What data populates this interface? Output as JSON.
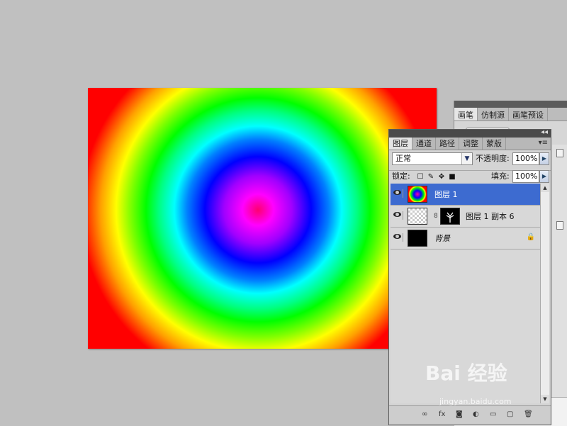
{
  "back_panel": {
    "tabs": [
      "画笔",
      "仿制源",
      "画笔预设"
    ]
  },
  "layers_panel": {
    "tabs": [
      "图层",
      "通道",
      "路径",
      "调整",
      "蒙版"
    ],
    "blend_mode": "正常",
    "opacity_label": "不透明度:",
    "opacity_value": "100%",
    "lock_label": "锁定:",
    "fill_label": "填充:",
    "fill_value": "100%",
    "layers": [
      {
        "name": "图层 1",
        "selected": true
      },
      {
        "name": "图层 1 副本 6",
        "selected": false
      },
      {
        "name": "背景",
        "selected": false,
        "locked": true
      }
    ]
  },
  "watermark": {
    "text": "Bai 经验",
    "url": "jingyan.baidu.com"
  },
  "colors": {
    "selection": "#3d6bd0",
    "workspace": "#c0c0c0"
  }
}
